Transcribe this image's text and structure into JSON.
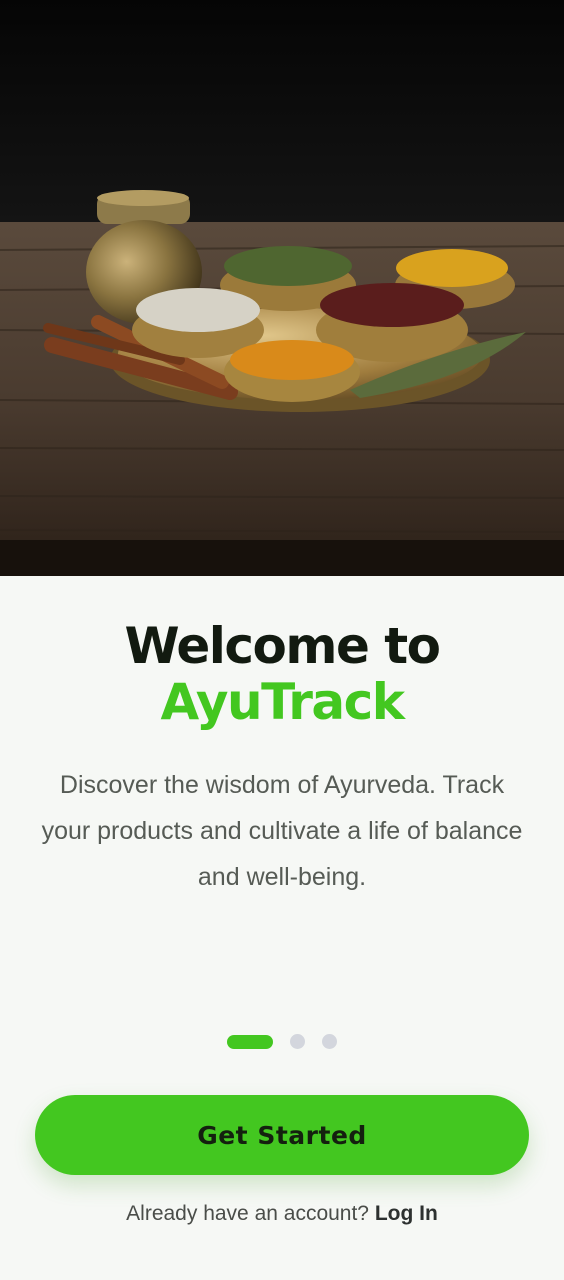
{
  "hero": {
    "image_description": "spices-thali-photo"
  },
  "welcome": {
    "title_line1": "Welcome to",
    "title_line2": "AyuTrack",
    "subtitle": "Discover the wisdom of Ayurveda. Track your products and cultivate a life of balance and well-being."
  },
  "pager": {
    "total_pages": 3,
    "current_page": 1
  },
  "actions": {
    "get_started_label": "Get Started",
    "login_prompt": "Already have an account?",
    "login_link": "Log In"
  },
  "colors": {
    "accent": "#43c720",
    "title_dark": "#121a10",
    "background": "#f6f8f5"
  }
}
